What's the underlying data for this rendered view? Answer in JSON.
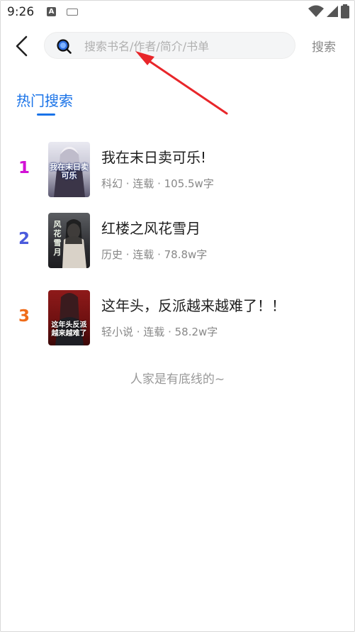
{
  "status_bar": {
    "time": "9:26",
    "notification_icons": [
      "a-app-icon",
      "keyboard-icon"
    ],
    "system_icons": [
      "wifi-icon",
      "cell-signal-icon",
      "battery-icon"
    ]
  },
  "header": {
    "back_icon": "chevron-left-icon",
    "search_icon": "search-icon",
    "search_placeholder": "搜索书名/作者/简介/书单",
    "search_value": "",
    "search_button_label": "搜索"
  },
  "tabs": {
    "hot_label": "热门搜索"
  },
  "books": [
    {
      "rank": "1",
      "rank_color": "#d211d6",
      "title": "我在末日卖可乐!",
      "meta": "科幻 · 连载 · 105.5w字",
      "cover_text": "我在末日卖可乐",
      "cover_bg": "#dcdce6"
    },
    {
      "rank": "2",
      "rank_color": "#4b5bdc",
      "title": "红楼之风花雪月",
      "meta": "历史 · 连载 · 78.8w字",
      "cover_text": "风花雪月",
      "cover_bg": "#2e2f33"
    },
    {
      "rank": "3",
      "rank_color": "#ef6c1a",
      "title": "这年头，反派越来越难了！！",
      "meta": "轻小说 · 连载 · 58.2w字",
      "cover_text": "这年头反派越来越难了",
      "cover_bg": "#7a1414"
    }
  ],
  "footer_note": "人家是有底线的~",
  "colors": {
    "accent": "#1a73e8",
    "annotation_arrow": "#e8262a"
  }
}
